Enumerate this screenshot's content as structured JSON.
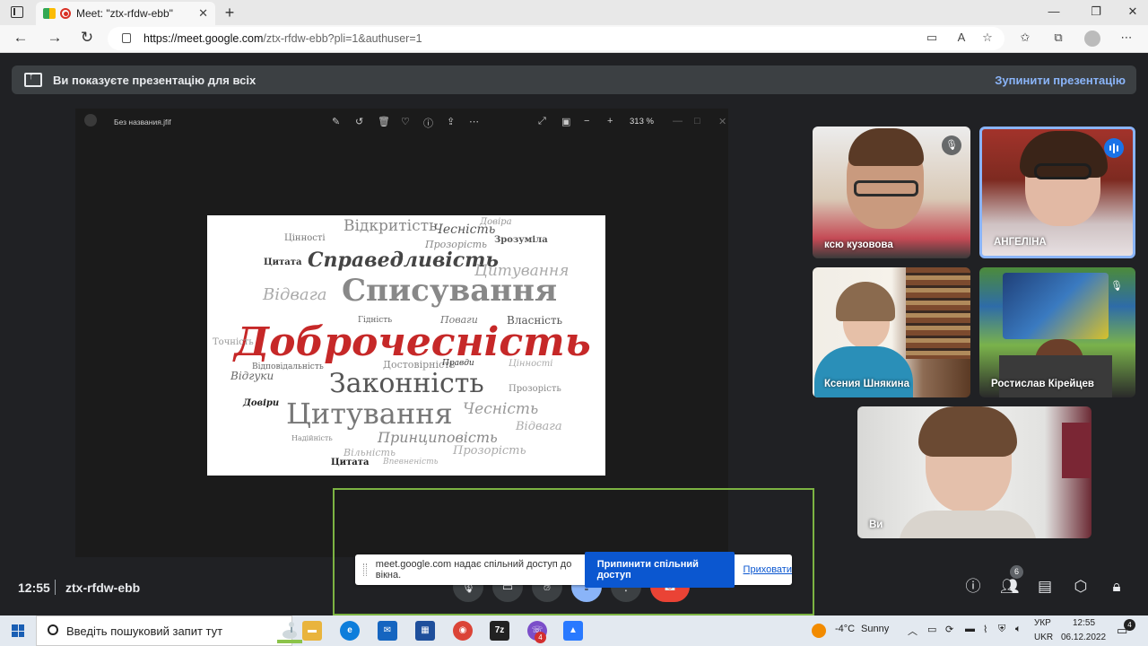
{
  "browser": {
    "tab_title": "Meet: \"ztx-rfdw-ebb\"",
    "tab_close": "✕",
    "new_tab": "+",
    "url_host": "https://meet.google.com",
    "url_rest": "/ztx-rfdw-ebb?pli=1&authuser=1",
    "window_controls": [
      "—",
      "❐",
      "✕"
    ]
  },
  "meet": {
    "presenting_banner": "Ви показуєте презентацію для всіх",
    "stop_presenting": "Зупинити презентацію",
    "viewer_filename": "Без названия.jfif",
    "viewer_zoom": "313 %",
    "time": "12:55",
    "meeting_code": "ztx-rfdw-ebb",
    "participants_count": "6",
    "participants": [
      {
        "name": "ксю кузовова",
        "muted": true
      },
      {
        "name": "АНГЕЛІНА",
        "speaking": true
      },
      {
        "name": "Ксения Шнякина",
        "muted": false
      },
      {
        "name": "Ростислав Кірейцев",
        "muted": true
      },
      {
        "name": "Ви",
        "muted": false
      }
    ],
    "share_notice": {
      "text": "meet.google.com надає спільний доступ до вікна.",
      "stop_button": "Припинити спільний доступ",
      "hide_link": "Приховати"
    }
  },
  "word_cloud": {
    "words": [
      "Доброчесність",
      "Списування",
      "Законність",
      "Цитування",
      "Справедливість",
      "Відкритість",
      "Чесність",
      "Відвага",
      "Принциповість",
      "Прозорість",
      "Поваги",
      "Власність",
      "Цитата",
      "Правди",
      "Гідність",
      "Точність",
      "Відповідальність",
      "Цінності",
      "Достовірність",
      "Довіра",
      "Зрозуміла",
      "Відгуки",
      "Довіри",
      "Вільність",
      "Надійність",
      "Впевненість"
    ]
  },
  "taskbar": {
    "search_placeholder": "Введіть пошуковий запит тут",
    "weather_temp": "-4°C",
    "weather_desc": "Sunny",
    "lang_top": "УКР",
    "lang_bottom": "UKR",
    "clock_time": "12:55",
    "clock_date": "06.12.2022",
    "notifications": "4",
    "app_badge": "4",
    "app_7z": "7z"
  },
  "colors": {
    "meet_bg": "#202124",
    "accent_blue": "#8ab4f8",
    "share_green": "#7cb342",
    "word_red": "#c62828"
  }
}
